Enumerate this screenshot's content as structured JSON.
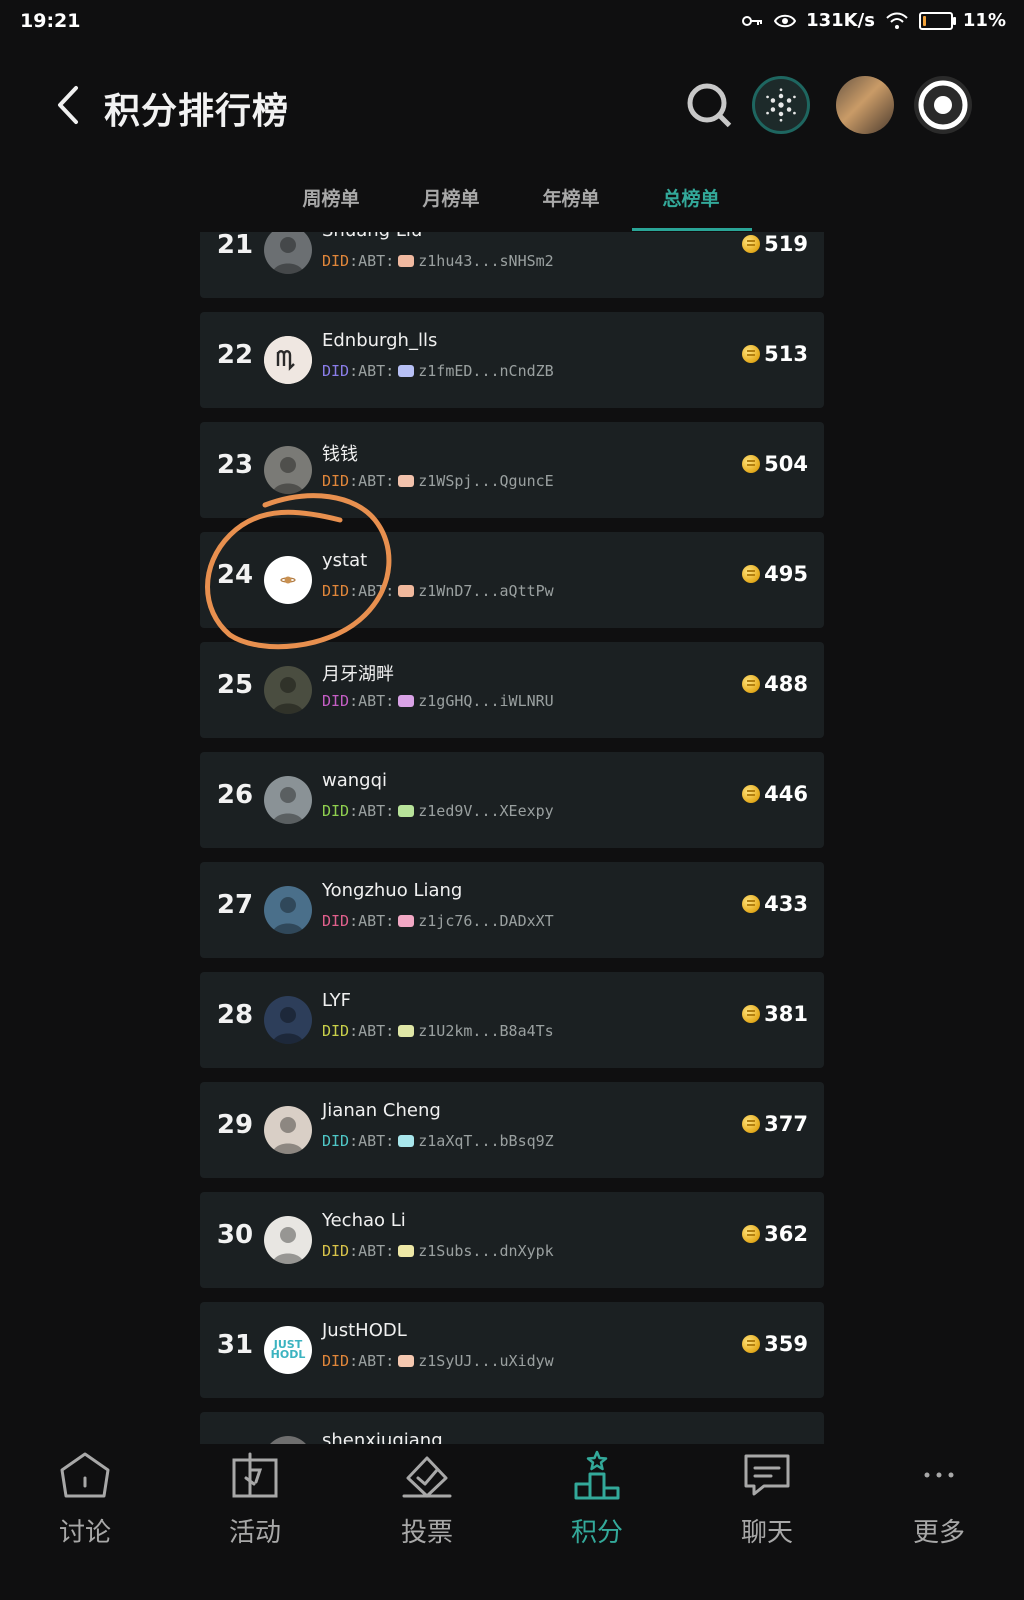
{
  "status": {
    "time": "19:21",
    "speed": "131K/s",
    "battery": "11%",
    "battery_level": 0.11
  },
  "header": {
    "title": "积分排行榜"
  },
  "tabs": [
    {
      "label": "周榜单",
      "active": false
    },
    {
      "label": "月榜单",
      "active": false
    },
    {
      "label": "年榜单",
      "active": false
    },
    {
      "label": "总榜单",
      "active": true
    }
  ],
  "did_prefix": {
    "did": "DID",
    "abt": ":ABT:"
  },
  "rows": [
    {
      "rank": "21",
      "name": "Shuang Liu",
      "address": "z1hu43...sNHSm2",
      "score": "519",
      "did_color": "#e0863a",
      "swatch": "#f0b9a0",
      "avatar_color": "#6b6f72"
    },
    {
      "rank": "22",
      "name": "Ednburgh_lls",
      "address": "z1fmED...nCndZB",
      "score": "513",
      "did_color": "#8a7de8",
      "swatch": "#b7c0f5",
      "avatar_color": "#e9e2dc"
    },
    {
      "rank": "23",
      "name": "钱钱",
      "address": "z1WSpj...QguncE",
      "score": "504",
      "did_color": "#e0863a",
      "swatch": "#f2c2ac",
      "avatar_color": "#7a7a76"
    },
    {
      "rank": "24",
      "name": "ystat",
      "address": "z1WnD7...aQttPw",
      "score": "495",
      "did_color": "#e0863a",
      "swatch": "#f0b89c",
      "avatar_color": "#ffffff"
    },
    {
      "rank": "25",
      "name": "月牙湖畔",
      "address": "z1gGHQ...iWLNRU",
      "score": "488",
      "did_color": "#c45ec4",
      "swatch": "#d9a2e6",
      "avatar_color": "#4a4d40"
    },
    {
      "rank": "26",
      "name": "wangqi",
      "address": "z1ed9V...XEexpy",
      "score": "446",
      "did_color": "#8fcf4f",
      "swatch": "#b8e39a",
      "avatar_color": "#8a9296"
    },
    {
      "rank": "27",
      "name": "Yongzhuo Liang",
      "address": "z1jc76...DADxXT",
      "score": "433",
      "did_color": "#e0608c",
      "swatch": "#f2a8c4",
      "avatar_color": "#4a6f8a"
    },
    {
      "rank": "28",
      "name": "LYF",
      "address": "z1U2km...B8a4Ts",
      "score": "381",
      "did_color": "#c9d04a",
      "swatch": "#dfe6a6",
      "avatar_color": "#2d3e5a"
    },
    {
      "rank": "29",
      "name": "Jianan Cheng",
      "address": "z1aXqT...bBsq9Z",
      "score": "377",
      "did_color": "#4fc7c7",
      "swatch": "#a8e6ec",
      "avatar_color": "#d9cfc6"
    },
    {
      "rank": "30",
      "name": "Yechao Li",
      "address": "z1Subs...dnXypk",
      "score": "362",
      "did_color": "#d8c34a",
      "swatch": "#eee8a6",
      "avatar_color": "#e8e6e2"
    },
    {
      "rank": "31",
      "name": "JustHODL",
      "address": "z1SyUJ...uXidyw",
      "score": "359",
      "did_color": "#e0863a",
      "swatch": "#f5c8b0",
      "avatar_color": "#ffffff"
    },
    {
      "rank": "",
      "name": "shenxiuqiang",
      "address": "",
      "score": "",
      "did_color": "#e0863a",
      "swatch": "#f0c0a0",
      "avatar_color": "#6e6e6e"
    }
  ],
  "avatar_text": {
    "justhodl": "JUST\nHODL"
  },
  "nav": [
    {
      "label": "讨论",
      "icon": "home-icon",
      "active": false
    },
    {
      "label": "活动",
      "icon": "gift-icon",
      "active": false
    },
    {
      "label": "投票",
      "icon": "vote-icon",
      "active": false
    },
    {
      "label": "积分",
      "icon": "podium-icon",
      "active": true
    },
    {
      "label": "聊天",
      "icon": "chat-icon",
      "active": false
    },
    {
      "label": "更多",
      "icon": "more-icon",
      "active": false
    }
  ],
  "colors": {
    "accent": "#33a99a",
    "annotation": "#e8904f",
    "row_bg": "#1b2022"
  }
}
